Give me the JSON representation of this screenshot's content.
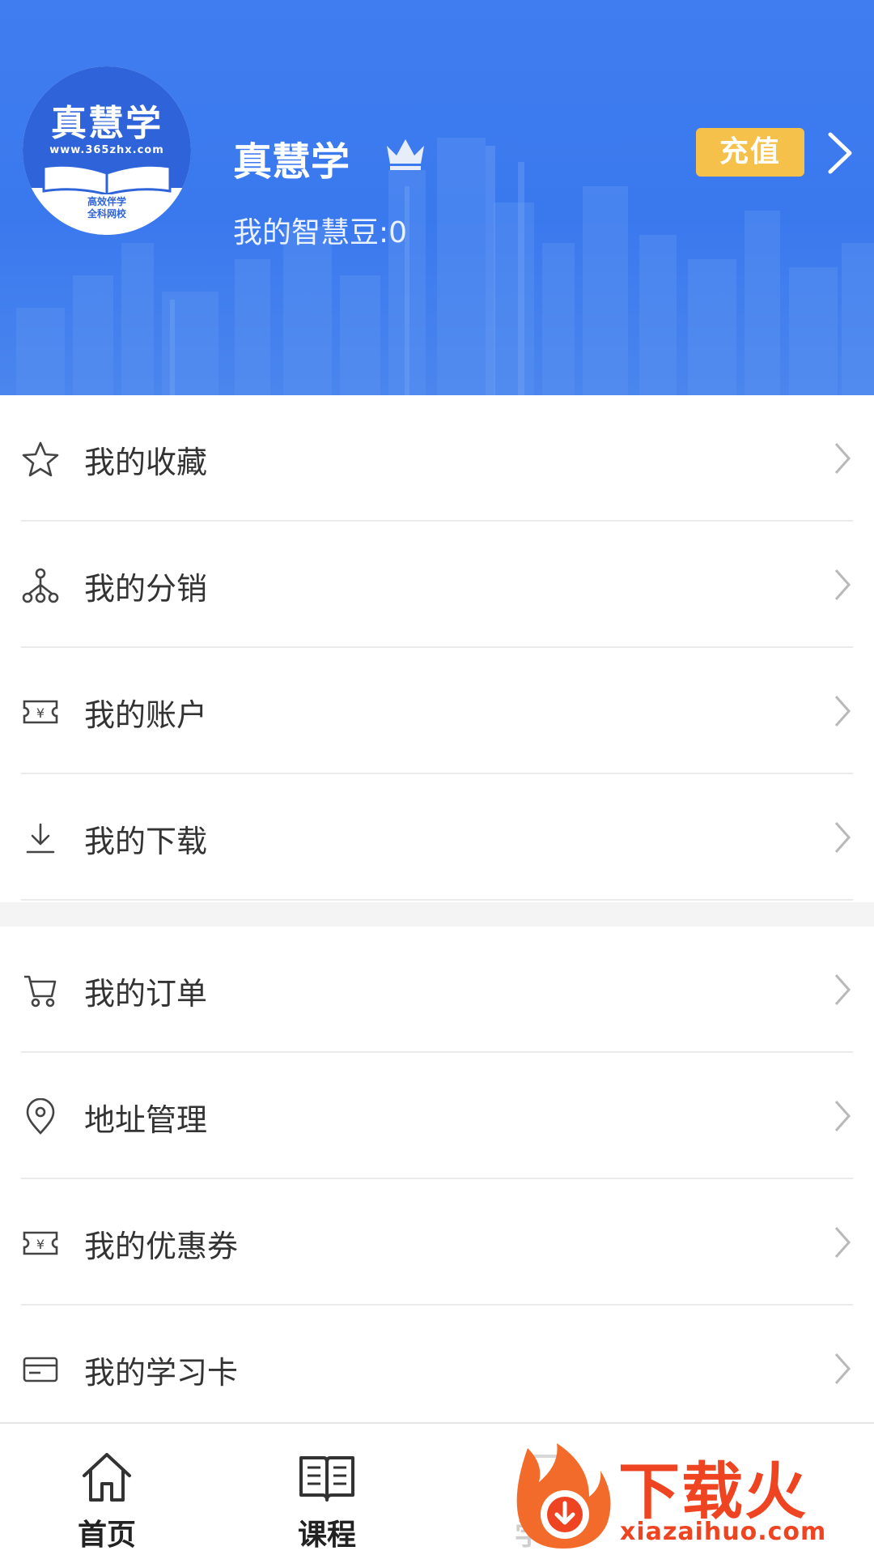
{
  "header": {
    "avatar": {
      "brand": "真慧学",
      "url": "www.365zhx.com",
      "slogan_line1": "高效伴学",
      "slogan_line2": "全科网校"
    },
    "username": "真慧学",
    "beans": "我的智慧豆:0",
    "recharge_label": "充值",
    "colors": {
      "background": "#3f7df0",
      "recharge": "#f5c14b"
    }
  },
  "menu_group_1": [
    {
      "label": "我的收藏",
      "icon": "star-icon"
    },
    {
      "label": "我的分销",
      "icon": "network-icon"
    },
    {
      "label": "我的账户",
      "icon": "yuan-ticket-icon"
    },
    {
      "label": "我的下载",
      "icon": "download-icon"
    }
  ],
  "menu_group_2": [
    {
      "label": "我的订单",
      "icon": "cart-icon"
    },
    {
      "label": "地址管理",
      "icon": "location-pin-icon"
    },
    {
      "label": "我的优惠券",
      "icon": "yuan-ticket-icon"
    },
    {
      "label": "我的学习卡",
      "icon": "card-icon"
    }
  ],
  "tabbar": {
    "tabs": [
      {
        "label": "首页",
        "icon": "home-icon"
      },
      {
        "label": "课程",
        "icon": "book-icon"
      },
      {
        "label": "学习",
        "icon": "study-icon"
      }
    ]
  },
  "watermark": {
    "text": "下载火",
    "url": "xiazaihuo.com"
  }
}
